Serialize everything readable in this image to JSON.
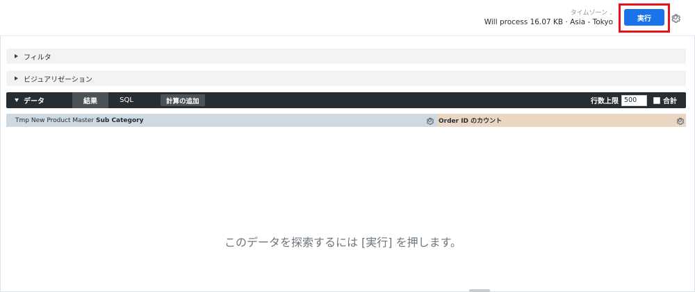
{
  "header": {
    "timezone_label": "タイムゾーン",
    "process_text": "Will process 16.07 KB · Asia - Tokyo",
    "run_label": "実行"
  },
  "sections": {
    "filter_label": "フィルタ",
    "visualization_label": "ビジュアリゼーション"
  },
  "data_bar": {
    "data_label": "データ",
    "tabs": [
      {
        "label": "結果",
        "active": true
      },
      {
        "label": "SQL",
        "active": false
      }
    ],
    "add_calc_label": "計算の追加",
    "row_limit_label": "行数上限",
    "row_limit_value": "500",
    "total_label": "合計",
    "total_checked": false
  },
  "columns": {
    "dimension_view": "Tmp New Product Master",
    "dimension_field": "Sub Category",
    "measure_label": "Order ID のカウント",
    "colors": {
      "dimension": "#cfd9e2",
      "measure": "#ead7c3"
    }
  },
  "empty_message": "このデータを探索するには [実行] を押します。",
  "colors": {
    "run_button": "#1a73e8",
    "highlight": "#e8121b",
    "data_bar": "#262d33"
  }
}
